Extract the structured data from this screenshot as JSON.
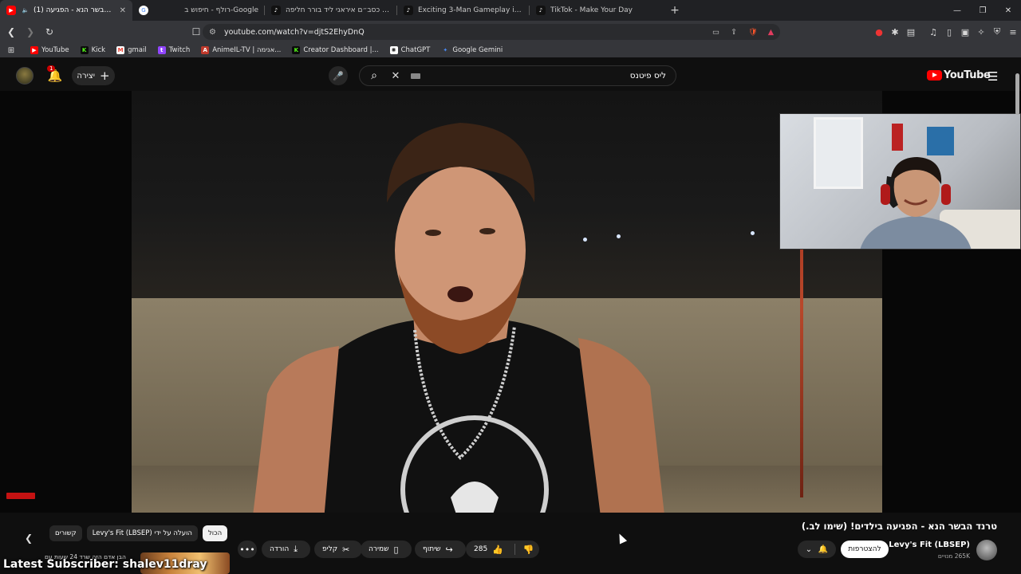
{
  "tabs": [
    {
      "label": "(1) טרנד הבשר הנא - הפגיעה",
      "favicon": "youtube-icon",
      "color": "#ff0000",
      "active": true
    },
    {
      "label": "רולף - חיפוש ב-Google",
      "favicon": "google-icon",
      "color": "#4285f4",
      "active": false
    },
    {
      "label": "ירוס כסב״ם איראני ליד בורר חליפה |",
      "favicon": "tiktok-icon",
      "color": "#111111",
      "active": false
    },
    {
      "label": "Exciting 3-Man Gameplay in Marvel",
      "favicon": "tiktok-icon",
      "color": "#111111",
      "active": false
    },
    {
      "label": "TikTok - Make Your Day",
      "favicon": "tiktok-icon",
      "color": "#111111",
      "active": false
    }
  ],
  "url": "youtube.com/watch?v=djtS2EhyDnQ",
  "bookmarks": [
    {
      "label": "YouTube",
      "icon": "youtube-icon",
      "color": "#ff0000"
    },
    {
      "label": "Kick",
      "icon": "kick-icon",
      "color": "#53fc18"
    },
    {
      "label": "gmail",
      "icon": "gmail-icon",
      "color": "#ea4335"
    },
    {
      "label": "Twitch",
      "icon": "twitch-icon",
      "color": "#9146ff"
    },
    {
      "label": "AnimeIL-TV | אנימה...",
      "icon": "animeil-icon",
      "color": "#c0392b"
    },
    {
      "label": "Creator Dashboard |...",
      "icon": "kick-icon",
      "color": "#53fc18"
    },
    {
      "label": "ChatGPT",
      "icon": "chatgpt-icon",
      "color": "#777777"
    },
    {
      "label": "Google Gemini",
      "icon": "gemini-icon",
      "color": "#4a8cf7"
    }
  ],
  "youtube": {
    "notifications": "1",
    "create_label": "יצירה",
    "search_query": "ליס פיטנס",
    "logo_text": "YouTube"
  },
  "video": {
    "title": "טרנד הבשר הנא - הפגיעה בילדים! (שימו לב.)",
    "channel": "Levy's Fit (LBSEP)",
    "subscribers": "265K מנויים",
    "join_label": "להצטרפות",
    "likes": "285",
    "share_label": "שיתוף",
    "save_label": "שמירה",
    "clip_label": "קליפ",
    "download_label": "הורדה"
  },
  "chips": {
    "all": "הכול",
    "uploaded_by": "Levy's Fit (LBSEP) הועלה על ידי",
    "related": "קשורים"
  },
  "thumbnail_text": "הבן אדם הזה שרד 24 שעות עם",
  "overlay": "Latest Subscriber: shalev11dray"
}
